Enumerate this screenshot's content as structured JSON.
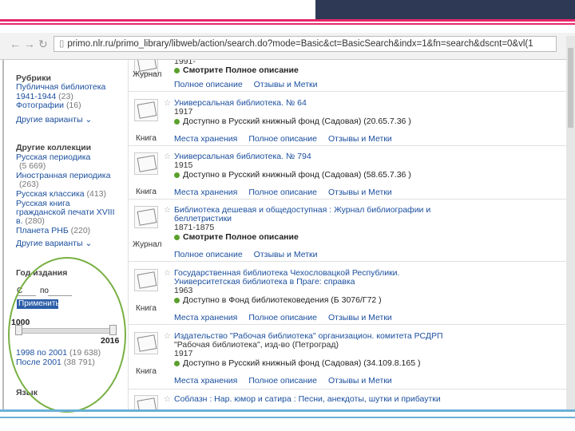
{
  "browser": {
    "url": "primo.nlr.ru/primo_library/libweb/action/search.do?mode=Basic&ct=BasicSearch&indx=1&fn=search&dscnt=0&vl(1"
  },
  "sidebar": {
    "rubrics_heading": "Рубрики",
    "rubric_items": [
      {
        "label": "Публичная библиотека",
        "label2": "1941-1944",
        "count": "(23)"
      },
      {
        "label": "Фотографии",
        "count": "(16)"
      }
    ],
    "rubrics_more": "Другие варианты",
    "collections_heading": "Другие коллекции",
    "collection_items": [
      {
        "label": "Русская периодика",
        "count": "(5 669)"
      },
      {
        "label": "Иностранная периодика",
        "count": "(263)"
      },
      {
        "label": "Русская классика",
        "count": "(413)"
      },
      {
        "label": "Русская книга гражданской печати XVIII в.",
        "label2": "гражданской печати XVIII",
        "label3": "в.",
        "count": "(280)"
      },
      {
        "label": "Планета РНБ",
        "count": "(220)"
      }
    ],
    "collections_more": "Другие варианты",
    "year_heading": "Год издания",
    "year_from": "С",
    "year_to_sep": "по",
    "apply_label": "Применить",
    "slider_min": "1000",
    "slider_max": "2016",
    "year_items": [
      {
        "label": "1998 по 2001",
        "count": "(19 638)"
      },
      {
        "label": "После 2001",
        "count": "(38 791)"
      }
    ],
    "lang_heading": "Язык"
  },
  "results": {
    "top_partial": {
      "year": "1991-",
      "type": "Журнал",
      "avail": "Смотрите Полное описание",
      "tabs": [
        "Полное описание",
        "Отзывы и Метки"
      ]
    },
    "records": [
      {
        "type": "Книга",
        "title": "Универсальная библиотека. № 64",
        "year": "1917",
        "avail": "Доступно в Русский книжный фонд (Садовая) (20.65.7.36 )",
        "avail_color": "#5aa02c",
        "tabs": [
          "Места хранения",
          "Полное описание",
          "Отзывы и Метки"
        ]
      },
      {
        "type": "Книга",
        "title": "Универсальная библиотека. № 794",
        "year": "1915",
        "avail": "Доступно в Русский книжный фонд (Садовая) (58.65.7.36 )",
        "avail_color": "#5aa02c",
        "tabs": [
          "Места хранения",
          "Полное описание",
          "Отзывы и Метки"
        ]
      },
      {
        "type": "Журнал",
        "title": "Библиотека дешевая и общедоступная : Журнал библиографии и",
        "title2": "беллетристики",
        "year": "1871-1875",
        "avail": "Смотрите Полное описание",
        "avail_color": "#5aa02c",
        "tabs": [
          "Полное описание",
          "Отзывы и Метки"
        ]
      },
      {
        "type": "Книга",
        "title": "Государственная библиотека Чехословацкой Республики.",
        "title2": "Университетская библиотека в Праге: справка",
        "year": "1963",
        "avail": "Доступно в Фонд библиотековедения (Б 3076/Г72 )",
        "avail_color": "#5aa02c",
        "tabs": [
          "Места хранения",
          "Полное описание",
          "Отзывы и Метки"
        ]
      },
      {
        "type": "Книга",
        "title": "Издательство \"Рабочая библиотека\" организацион. комитета РСДРП",
        "sub": "\"Рабочая библиотека\", изд-во (Петроград)",
        "year": "1917",
        "avail": "Доступно в Русский книжный фонд (Садовая) (34.109.8.165 )",
        "avail_color": "#5aa02c",
        "tabs": [
          "Места хранения",
          "Полное описание",
          "Отзывы и Метки"
        ]
      }
    ],
    "bottom_partial": {
      "title": "Соблазн : Нар. юмор и сатира : Песни, анекдоты, шутки и прибаутки"
    }
  },
  "colors": {
    "accent_pink": "#e8256b",
    "navy": "#2e3a55",
    "link": "#1a4e9e",
    "annotation_circle": "#78b043"
  }
}
